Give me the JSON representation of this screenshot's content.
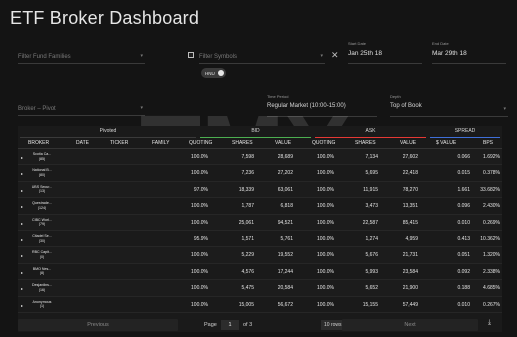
{
  "app": {
    "title": "ETF Broker Dashboard"
  },
  "filters": {
    "fund_families_placeholder": "Filter Fund Families",
    "symbols_placeholder": "Filter Symbols",
    "start_date_label": "Start Date",
    "start_date_value": "Jan 25th 18",
    "end_date_label": "End Date",
    "end_date_value": "Mar 29th 18",
    "toggle_label": "HNU",
    "broker_label": "Broker",
    "pivot_label": "Pivot",
    "time_period_label": "Time Period",
    "time_period_value": "Regular Market (10:00-15:00)",
    "depth_label": "Depth",
    "depth_value": "Top of Book"
  },
  "table": {
    "groups": [
      {
        "label": "Pivoted",
        "color": "#3a3a3a"
      },
      {
        "label": "BID",
        "color": "#4caf50"
      },
      {
        "label": "ASK",
        "color": "#e53935"
      },
      {
        "label": "SPREAD",
        "color": "#3f6fd8"
      }
    ],
    "headers": [
      "BROKER",
      "DATE",
      "TICKER",
      "FAMILY",
      "QUOTING",
      "SHARES",
      "VALUE",
      "QUOTING",
      "SHARES",
      "VALUE",
      "$ VALUE",
      "BPS"
    ],
    "rows": [
      {
        "broker": "Scotia Ca...",
        "count": "(85)",
        "vals": [
          "100.0%",
          "7,598",
          "28,689",
          "100.0%",
          "7,134",
          "27,602",
          "0.066",
          "1.692%"
        ]
      },
      {
        "broker": "National B...",
        "count": "(80)",
        "vals": [
          "100.0%",
          "7,236",
          "27,202",
          "100.0%",
          "5,695",
          "22,418",
          "0.015",
          "0.378%"
        ]
      },
      {
        "broker": "UBS Secur...",
        "count": "(13)",
        "vals": [
          "97.0%",
          "18,339",
          "63,061",
          "100.0%",
          "11,915",
          "78,270",
          "1.661",
          "33.682%"
        ]
      },
      {
        "broker": "Questrade...",
        "count": "(124)",
        "vals": [
          "100.0%",
          "1,787",
          "6,818",
          "100.0%",
          "3,473",
          "13,351",
          "0.096",
          "2.430%"
        ]
      },
      {
        "broker": "CIBC Worl...",
        "count": "(79)",
        "vals": [
          "100.0%",
          "25,061",
          "94,521",
          "100.0%",
          "22,587",
          "85,415",
          "0.010",
          "0.269%"
        ]
      },
      {
        "broker": "Citadel Se...",
        "count": "(30)",
        "vals": [
          "95.9%",
          "1,571",
          "5,761",
          "100.0%",
          "1,274",
          "4,959",
          "0.413",
          "10.362%"
        ]
      },
      {
        "broker": "RBC Capit...",
        "count": "(0)",
        "vals": [
          "100.0%",
          "5,229",
          "19,552",
          "100.0%",
          "5,676",
          "21,731",
          "0.051",
          "1.320%"
        ]
      },
      {
        "broker": "BMO Nes...",
        "count": "(8)",
        "vals": [
          "100.0%",
          "4,576",
          "17,244",
          "100.0%",
          "5,993",
          "23,584",
          "0.092",
          "2.338%"
        ]
      },
      {
        "broker": "Desjardins...",
        "count": "(16)",
        "vals": [
          "100.0%",
          "5,475",
          "20,584",
          "100.0%",
          "5,652",
          "21,900",
          "0.188",
          "4.685%"
        ]
      },
      {
        "broker": "Anonymous",
        "count": "(1)",
        "vals": [
          "100.0%",
          "15,005",
          "56,672",
          "100.0%",
          "15,155",
          "57,449",
          "0.010",
          "0.267%"
        ]
      }
    ]
  },
  "pagination": {
    "previous_label": "Previous",
    "page_label": "Page",
    "page_value": "1",
    "of_label": "of 3",
    "rows_value": "10 rows",
    "next_label": "Next"
  },
  "icons": {
    "download": "download-icon",
    "checkbox": "checkbox-icon",
    "chevron": "chevron-down-icon",
    "close": "close-icon"
  }
}
